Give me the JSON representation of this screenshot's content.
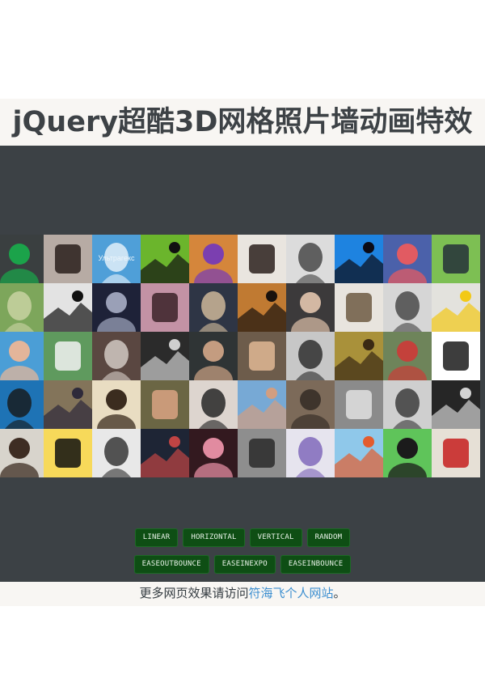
{
  "header": {
    "title": "jQuery超酷3D网格照片墙动画特效"
  },
  "grid": {
    "tiles": [
      {
        "icon": "green-robot-avatar-icon",
        "bg": "#3a3f40",
        "fg": "#1ba34a"
      },
      {
        "icon": "woman-portrait-photo",
        "bg": "#b7aba4",
        "fg": "#2a1f1c"
      },
      {
        "icon": "ultragex-logo-tile",
        "bg": "#4f9fd8",
        "fg": "#eaf4fb",
        "text": "Ультрагекс"
      },
      {
        "icon": "green-smiley-box-icon",
        "bg": "#6bb52c",
        "fg": "#111111"
      },
      {
        "icon": "crowned-cat-illustration",
        "bg": "#d5863b",
        "fg": "#7b3fb0"
      },
      {
        "icon": "smiling-woman-photo",
        "bg": "#e9e5df",
        "fg": "#2b211d"
      },
      {
        "icon": "woman-monochrome-photo",
        "bg": "#dcdcdc",
        "fg": "#404040"
      },
      {
        "icon": "bowtie-logo-icon",
        "bg": "#1e83e0",
        "fg": "#0b0b16"
      },
      {
        "icon": "jumping-person-photo",
        "bg": "#4b61aa",
        "fg": "#e15b62"
      },
      {
        "icon": "cartoon-glasses-avatar",
        "bg": "#7dbf53",
        "fg": "#25303a"
      },
      {
        "icon": "meditation-landscape-photo",
        "bg": "#7da65b",
        "fg": "#cdd6a6"
      },
      {
        "icon": "pixel-glasses-avatar",
        "bg": "#e3e3e3",
        "fg": "#111111"
      },
      {
        "icon": "couple-night-photo",
        "bg": "#1e2238",
        "fg": "#9aa0b7"
      },
      {
        "icon": "girl-portrait-photo",
        "bg": "#c392a5",
        "fg": "#3b2228"
      },
      {
        "icon": "posing-girl-photo",
        "bg": "#2e3545",
        "fg": "#d7bf9e"
      },
      {
        "icon": "man-glasses-closeup-photo",
        "bg": "#c07a32",
        "fg": "#1a120d"
      },
      {
        "icon": "woman-dark-hair-photo",
        "bg": "#3c3a3b",
        "fg": "#d3b8a3"
      },
      {
        "icon": "sloth-photo",
        "bg": "#e8e4de",
        "fg": "#6d5a43"
      },
      {
        "icon": "cat-photo",
        "bg": "#d6d6d6",
        "fg": "#414141"
      },
      {
        "icon": "lego-head-photo",
        "bg": "#e3e2dd",
        "fg": "#f2c916"
      },
      {
        "icon": "beach-woman-photo",
        "bg": "#4b9ed6",
        "fg": "#e3b59a"
      },
      {
        "icon": "woman-garden-photo",
        "bg": "#5f9a5e",
        "fg": "#f2f2f2"
      },
      {
        "icon": "mustache-man-photo",
        "bg": "#5a4741",
        "fg": "#d8d1ca"
      },
      {
        "icon": "skull-art-photo",
        "bg": "#2b2b2b",
        "fg": "#cfcfcf"
      },
      {
        "icon": "man-suit-photo",
        "bg": "#2f3435",
        "fg": "#c49c80"
      },
      {
        "icon": "young-man-photo",
        "bg": "#6d5c4b",
        "fg": "#e0b794"
      },
      {
        "icon": "man-beard-bw-photo",
        "bg": "#c7c7c7",
        "fg": "#262626"
      },
      {
        "icon": "man-yellow-photo",
        "bg": "#a9913a",
        "fg": "#3a2a14"
      },
      {
        "icon": "man-plaid-photo",
        "bg": "#6e845a",
        "fg": "#c4413b"
      },
      {
        "icon": "mustache-cowboy-icon",
        "bg": "#ffffff",
        "fg": "#1b1b1b"
      },
      {
        "icon": "bearded-man-icon",
        "bg": "#1e73b5",
        "fg": "#161616"
      },
      {
        "icon": "man-suit-smile-photo",
        "bg": "#83745a",
        "fg": "#2e2a3a"
      },
      {
        "icon": "signature-art-photo",
        "bg": "#e9ddc2",
        "fg": "#3b2c1f"
      },
      {
        "icon": "smiling-man-photo",
        "bg": "#6b6644",
        "fg": "#d9a382"
      },
      {
        "icon": "man-black-shirt-photo",
        "bg": "#ddd5cf",
        "fg": "#1c1c1c"
      },
      {
        "icon": "man-closeup-photo",
        "bg": "#77a9d5",
        "fg": "#d29e80"
      },
      {
        "icon": "man-office-photo",
        "bg": "#7c6a59",
        "fg": "#3e342c"
      },
      {
        "icon": "bald-man-bw-photo",
        "bg": "#8b8b8b",
        "fg": "#e0e0e0"
      },
      {
        "icon": "man-bw-smile-photo",
        "bg": "#cfcfcf",
        "fg": "#333333"
      },
      {
        "icon": "man-bw-portrait-photo",
        "bg": "#262626",
        "fg": "#d3d3d3"
      },
      {
        "icon": "man-stubble-photo",
        "bg": "#d8d4cc",
        "fg": "#3e2d23"
      },
      {
        "icon": "robot-head-illustration",
        "bg": "#f7d95a",
        "fg": "#111111"
      },
      {
        "icon": "chubby-man-photo",
        "bg": "#e8e8e8",
        "fg": "#2c2c2c"
      },
      {
        "icon": "man-red-shirt-photo",
        "bg": "#1e2535",
        "fg": "#c14444"
      },
      {
        "icon": "cartoon-girl-illustration",
        "bg": "#33191f",
        "fg": "#e18ba0"
      },
      {
        "icon": "sketch-drawing-photo",
        "bg": "#8e8e8e",
        "fg": "#2a2a2a"
      },
      {
        "icon": "purple-cartoon-face-icon",
        "bg": "#e6e4ee",
        "fg": "#7b62b8"
      },
      {
        "icon": "html5-pony-illustration",
        "bg": "#8fc8ea",
        "fg": "#e35c2e"
      },
      {
        "icon": "cartoon-boy-avatar",
        "bg": "#5fc45a",
        "fg": "#1b1b1b"
      },
      {
        "icon": "red-hood-character-icon",
        "bg": "#e6e0d6",
        "fg": "#c51e1e"
      }
    ]
  },
  "controls": {
    "row1": [
      "LINEAR",
      "HORIZONTAL",
      "VERTICAL",
      "RANDOM"
    ],
    "row2": [
      "EASEOUTBOUNCE",
      "EASEINEXPO",
      "EASEINBOUNCE"
    ]
  },
  "footer": {
    "prefix": "更多网页效果请访问",
    "link": "符海飞个人网站",
    "suffix": "。"
  }
}
